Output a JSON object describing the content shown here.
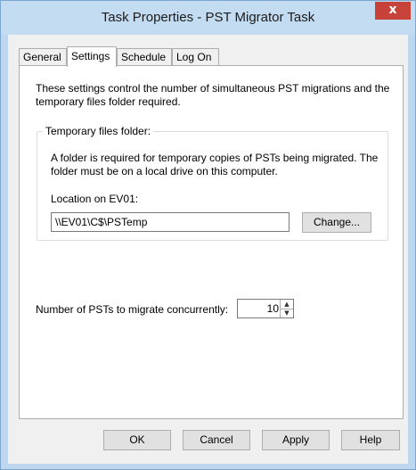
{
  "window": {
    "title": "Task Properties - PST Migrator Task",
    "close_glyph": "x"
  },
  "tabs": [
    {
      "label": "General",
      "active": false
    },
    {
      "label": "Settings",
      "active": true
    },
    {
      "label": "Schedule",
      "active": false
    },
    {
      "label": "Log On",
      "active": false
    }
  ],
  "settings": {
    "description": "These settings control the number of simultaneous PST migrations and the temporary files folder required.",
    "temp_group": {
      "legend": "Temporary files folder:",
      "info": "A folder is required for temporary copies of PSTs being migrated. The folder must be on a local drive on this computer.",
      "location_label": "Location on EV01:",
      "location_value": "\\\\EV01\\C$\\PSTemp",
      "change_button": "Change..."
    },
    "concurrency_label": "Number of PSTs to migrate concurrently:",
    "concurrency_value": "10"
  },
  "buttons": {
    "ok": "OK",
    "cancel": "Cancel",
    "apply": "Apply",
    "help": "Help"
  }
}
